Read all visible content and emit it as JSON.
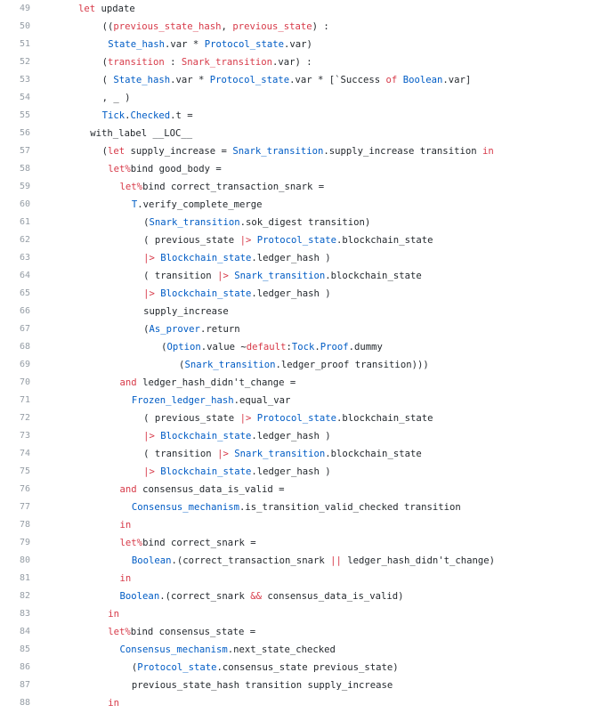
{
  "colors": {
    "keyword": "#d73a49",
    "module": "#005cc5",
    "text": "#24292e",
    "line_number": "#959da5",
    "background": "#ffffff"
  },
  "lines": [
    {
      "number": "49",
      "indent": 0,
      "tokens": [
        {
          "t": "let",
          "c": "kw"
        },
        {
          "t": " update",
          "c": ""
        }
      ]
    },
    {
      "number": "50",
      "indent": 4,
      "tokens": [
        {
          "t": "((",
          "c": ""
        },
        {
          "t": "previous_state_hash",
          "c": "kw"
        },
        {
          "t": ", ",
          "c": ""
        },
        {
          "t": "previous_state",
          "c": "kw"
        },
        {
          "t": ") :",
          "c": ""
        }
      ]
    },
    {
      "number": "51",
      "indent": 5,
      "tokens": [
        {
          "t": "State_hash",
          "c": "ty"
        },
        {
          "t": ".var * ",
          "c": ""
        },
        {
          "t": "Protocol_state",
          "c": "ty"
        },
        {
          "t": ".var)",
          "c": ""
        }
      ]
    },
    {
      "number": "52",
      "indent": 4,
      "tokens": [
        {
          "t": "(",
          "c": ""
        },
        {
          "t": "transition",
          "c": "kw"
        },
        {
          "t": " : ",
          "c": ""
        },
        {
          "t": "Snark_transition",
          "c": "kw"
        },
        {
          "t": ".var) :",
          "c": ""
        }
      ]
    },
    {
      "number": "53",
      "indent": 4,
      "tokens": [
        {
          "t": "( ",
          "c": ""
        },
        {
          "t": "State_hash",
          "c": "ty"
        },
        {
          "t": ".var * ",
          "c": ""
        },
        {
          "t": "Protocol_state",
          "c": "ty"
        },
        {
          "t": ".var * [`Success ",
          "c": ""
        },
        {
          "t": "of",
          "c": "kw"
        },
        {
          "t": " ",
          "c": ""
        },
        {
          "t": "Boolean",
          "c": "ty"
        },
        {
          "t": ".var]",
          "c": ""
        }
      ]
    },
    {
      "number": "54",
      "indent": 4,
      "tokens": [
        {
          "t": ", _ )",
          "c": ""
        }
      ]
    },
    {
      "number": "55",
      "indent": 4,
      "tokens": [
        {
          "t": "Tick",
          "c": "ty"
        },
        {
          "t": ".",
          "c": ""
        },
        {
          "t": "Checked",
          "c": "ty"
        },
        {
          "t": ".t =",
          "c": ""
        }
      ]
    },
    {
      "number": "56",
      "indent": 2,
      "tokens": [
        {
          "t": "with_label __LOC__",
          "c": ""
        }
      ]
    },
    {
      "number": "57",
      "indent": 4,
      "tokens": [
        {
          "t": "(",
          "c": ""
        },
        {
          "t": "let",
          "c": "kw"
        },
        {
          "t": " supply_increase = ",
          "c": ""
        },
        {
          "t": "Snark_transition",
          "c": "ty"
        },
        {
          "t": ".supply_increase transition ",
          "c": ""
        },
        {
          "t": "in",
          "c": "kw"
        }
      ]
    },
    {
      "number": "58",
      "indent": 5,
      "tokens": [
        {
          "t": "let%",
          "c": "kw"
        },
        {
          "t": "bind good_body =",
          "c": ""
        }
      ]
    },
    {
      "number": "59",
      "indent": 7,
      "tokens": [
        {
          "t": "let%",
          "c": "kw"
        },
        {
          "t": "bind correct_transaction_snark =",
          "c": ""
        }
      ]
    },
    {
      "number": "60",
      "indent": 9,
      "tokens": [
        {
          "t": "T",
          "c": "ty"
        },
        {
          "t": ".verify_complete_merge",
          "c": ""
        }
      ]
    },
    {
      "number": "61",
      "indent": 11,
      "tokens": [
        {
          "t": "(",
          "c": ""
        },
        {
          "t": "Snark_transition",
          "c": "ty"
        },
        {
          "t": ".sok_digest transition)",
          "c": ""
        }
      ]
    },
    {
      "number": "62",
      "indent": 11,
      "tokens": [
        {
          "t": "( previous_state ",
          "c": ""
        },
        {
          "t": "|>",
          "c": "op"
        },
        {
          "t": " ",
          "c": ""
        },
        {
          "t": "Protocol_state",
          "c": "ty"
        },
        {
          "t": ".blockchain_state",
          "c": ""
        }
      ]
    },
    {
      "number": "63",
      "indent": 11,
      "tokens": [
        {
          "t": "|>",
          "c": "op"
        },
        {
          "t": " ",
          "c": ""
        },
        {
          "t": "Blockchain_state",
          "c": "ty"
        },
        {
          "t": ".ledger_hash )",
          "c": ""
        }
      ]
    },
    {
      "number": "64",
      "indent": 11,
      "tokens": [
        {
          "t": "( transition ",
          "c": ""
        },
        {
          "t": "|>",
          "c": "op"
        },
        {
          "t": " ",
          "c": ""
        },
        {
          "t": "Snark_transition",
          "c": "ty"
        },
        {
          "t": ".blockchain_state",
          "c": ""
        }
      ]
    },
    {
      "number": "65",
      "indent": 11,
      "tokens": [
        {
          "t": "|>",
          "c": "op"
        },
        {
          "t": " ",
          "c": ""
        },
        {
          "t": "Blockchain_state",
          "c": "ty"
        },
        {
          "t": ".ledger_hash )",
          "c": ""
        }
      ]
    },
    {
      "number": "66",
      "indent": 11,
      "tokens": [
        {
          "t": "supply_increase",
          "c": ""
        }
      ]
    },
    {
      "number": "67",
      "indent": 11,
      "tokens": [
        {
          "t": "(",
          "c": ""
        },
        {
          "t": "As_prover",
          "c": "ty"
        },
        {
          "t": ".return",
          "c": ""
        }
      ]
    },
    {
      "number": "68",
      "indent": 14,
      "tokens": [
        {
          "t": "(",
          "c": ""
        },
        {
          "t": "Option",
          "c": "ty"
        },
        {
          "t": ".value ~",
          "c": ""
        },
        {
          "t": "default",
          "c": "kw"
        },
        {
          "t": ":",
          "c": ""
        },
        {
          "t": "Tock",
          "c": "ty"
        },
        {
          "t": ".",
          "c": ""
        },
        {
          "t": "Proof",
          "c": "ty"
        },
        {
          "t": ".dummy",
          "c": ""
        }
      ]
    },
    {
      "number": "69",
      "indent": 17,
      "tokens": [
        {
          "t": "(",
          "c": ""
        },
        {
          "t": "Snark_transition",
          "c": "ty"
        },
        {
          "t": ".ledger_proof transition)))",
          "c": ""
        }
      ]
    },
    {
      "number": "70",
      "indent": 7,
      "tokens": [
        {
          "t": "and",
          "c": "kw"
        },
        {
          "t": " ledger_hash_didn't_change =",
          "c": ""
        }
      ]
    },
    {
      "number": "71",
      "indent": 9,
      "tokens": [
        {
          "t": "Frozen_ledger_hash",
          "c": "ty"
        },
        {
          "t": ".equal_var",
          "c": ""
        }
      ]
    },
    {
      "number": "72",
      "indent": 11,
      "tokens": [
        {
          "t": "( previous_state ",
          "c": ""
        },
        {
          "t": "|>",
          "c": "op"
        },
        {
          "t": " ",
          "c": ""
        },
        {
          "t": "Protocol_state",
          "c": "ty"
        },
        {
          "t": ".blockchain_state",
          "c": ""
        }
      ]
    },
    {
      "number": "73",
      "indent": 11,
      "tokens": [
        {
          "t": "|>",
          "c": "op"
        },
        {
          "t": " ",
          "c": ""
        },
        {
          "t": "Blockchain_state",
          "c": "ty"
        },
        {
          "t": ".ledger_hash )",
          "c": ""
        }
      ]
    },
    {
      "number": "74",
      "indent": 11,
      "tokens": [
        {
          "t": "( transition ",
          "c": ""
        },
        {
          "t": "|>",
          "c": "op"
        },
        {
          "t": " ",
          "c": ""
        },
        {
          "t": "Snark_transition",
          "c": "ty"
        },
        {
          "t": ".blockchain_state",
          "c": ""
        }
      ]
    },
    {
      "number": "75",
      "indent": 11,
      "tokens": [
        {
          "t": "|>",
          "c": "op"
        },
        {
          "t": " ",
          "c": ""
        },
        {
          "t": "Blockchain_state",
          "c": "ty"
        },
        {
          "t": ".ledger_hash )",
          "c": ""
        }
      ]
    },
    {
      "number": "76",
      "indent": 7,
      "tokens": [
        {
          "t": "and",
          "c": "kw"
        },
        {
          "t": " consensus_data_is_valid =",
          "c": ""
        }
      ]
    },
    {
      "number": "77",
      "indent": 9,
      "tokens": [
        {
          "t": "Consensus_mechanism",
          "c": "ty"
        },
        {
          "t": ".is_transition_valid_checked transition",
          "c": ""
        }
      ]
    },
    {
      "number": "78",
      "indent": 7,
      "tokens": [
        {
          "t": "in",
          "c": "kw"
        }
      ]
    },
    {
      "number": "79",
      "indent": 7,
      "tokens": [
        {
          "t": "let%",
          "c": "kw"
        },
        {
          "t": "bind correct_snark =",
          "c": ""
        }
      ]
    },
    {
      "number": "80",
      "indent": 9,
      "tokens": [
        {
          "t": "Boolean",
          "c": "ty"
        },
        {
          "t": ".(correct_transaction_snark ",
          "c": ""
        },
        {
          "t": "||",
          "c": "op"
        },
        {
          "t": " ledger_hash_didn't_change)",
          "c": ""
        }
      ]
    },
    {
      "number": "81",
      "indent": 7,
      "tokens": [
        {
          "t": "in",
          "c": "kw"
        }
      ]
    },
    {
      "number": "82",
      "indent": 7,
      "tokens": [
        {
          "t": "Boolean",
          "c": "ty"
        },
        {
          "t": ".(correct_snark ",
          "c": ""
        },
        {
          "t": "&&",
          "c": "op"
        },
        {
          "t": " consensus_data_is_valid)",
          "c": ""
        }
      ]
    },
    {
      "number": "83",
      "indent": 5,
      "tokens": [
        {
          "t": "in",
          "c": "kw"
        }
      ]
    },
    {
      "number": "84",
      "indent": 5,
      "tokens": [
        {
          "t": "let%",
          "c": "kw"
        },
        {
          "t": "bind consensus_state =",
          "c": ""
        }
      ]
    },
    {
      "number": "85",
      "indent": 7,
      "tokens": [
        {
          "t": "Consensus_mechanism",
          "c": "ty"
        },
        {
          "t": ".next_state_checked",
          "c": ""
        }
      ]
    },
    {
      "number": "86",
      "indent": 9,
      "tokens": [
        {
          "t": "(",
          "c": ""
        },
        {
          "t": "Protocol_state",
          "c": "ty"
        },
        {
          "t": ".consensus_state previous_state)",
          "c": ""
        }
      ]
    },
    {
      "number": "87",
      "indent": 9,
      "tokens": [
        {
          "t": "previous_state_hash transition supply_increase",
          "c": ""
        }
      ]
    },
    {
      "number": "88",
      "indent": 5,
      "tokens": [
        {
          "t": "in",
          "c": "kw"
        }
      ]
    }
  ]
}
